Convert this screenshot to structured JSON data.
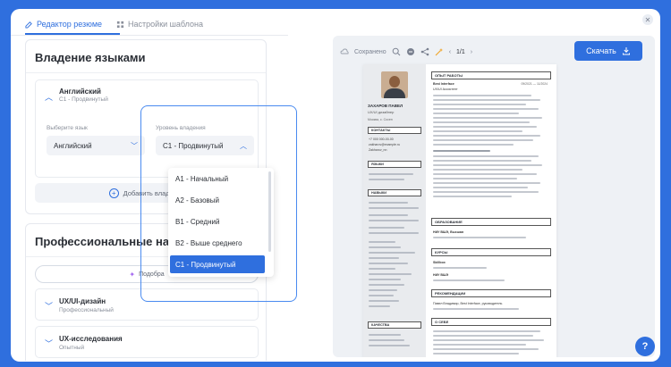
{
  "tabs": [
    {
      "label": "Редактор резюме",
      "active": true
    },
    {
      "label": "Настройки шаблона",
      "active": false
    }
  ],
  "languages_section": {
    "title": "Владение языками",
    "item": {
      "name": "Английский",
      "level": "C1 - Продвинутый"
    },
    "label_language": "Выберите язык",
    "label_level": "Уровень владения",
    "selected_language": "Английский",
    "selected_level": "C1 - Продвинутый",
    "add_button": "Добавить владение"
  },
  "level_dropdown": {
    "options": [
      "A1 - Начальный",
      "A2 - Базовый",
      "B1 - Средний",
      "B2 - Выше среднего",
      "C1 - Продвинутый"
    ],
    "selected": "C1 - Продвинутый"
  },
  "skills_section": {
    "title": "Профессиональные нав",
    "pick_button": "Подобра",
    "items": [
      {
        "name": "UX/UI-дизайн",
        "level": "Профессиональный"
      },
      {
        "name": "UX-исследования",
        "level": "Опытный"
      }
    ]
  },
  "preview_toolbar": {
    "saved": "Сохранено",
    "page": "1/1",
    "download": "Скачать"
  },
  "resume": {
    "name": "ЗАХАРОВ ПАВЕЛ",
    "role": "UX/UI дизайнер",
    "city": "Москва, с. Сосен",
    "sidebar_sections": [
      "КОНТАКТЫ",
      "ЯЗЫКИ",
      "НАВЫКИ",
      "КАЧЕСТВА"
    ],
    "contacts": [
      "+7 000 000-00-00",
      "zakharov@example.ru",
      "Zakharov_nn"
    ],
    "main_sections": [
      "ОПЫТ РАБОТЫ",
      "ОБРАЗОВАНИЕ",
      "КУРСЫ",
      "РЕКОМЕНДАЦИИ",
      "О СЕБЕ"
    ],
    "job_company": "Best Interface",
    "job_title": "UX/UI Ассистент",
    "job_dates": "09/2021 — 11/2024",
    "education_school": "НИУ ВШЭ, Высшая",
    "courses": [
      "Skillbox",
      "НИУ ВШЭ"
    ],
    "recommendation": "Павел Владимир, Best Interface, руководитель"
  },
  "help_label": "?"
}
